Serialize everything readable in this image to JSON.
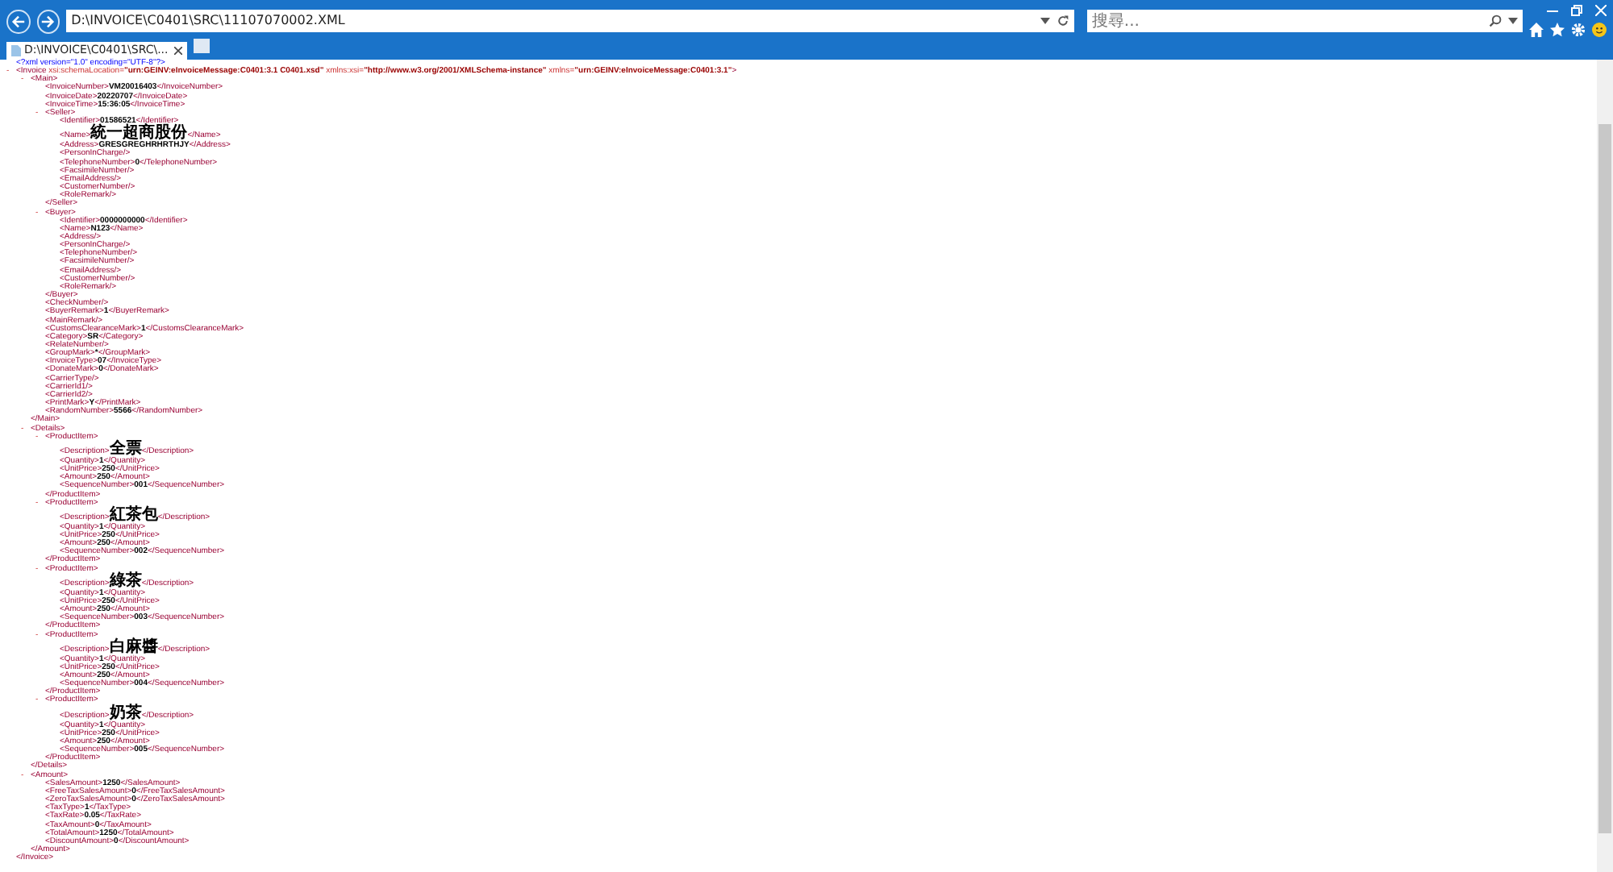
{
  "browser": {
    "address": "D:\\INVOICE\\C0401\\SRC\\11107070002.XML",
    "search_placeholder": "搜尋...",
    "tab_title": "D:\\INVOICE\\C0401\\SRC\\..."
  },
  "declaration": "<?xml version=\"1.0\" encoding=\"UTF-8\"?>",
  "root": {
    "toggle": "-",
    "open": "<Invoice",
    "attributes": [
      {
        "name": " xsi:schemaLocation=",
        "value": "\"urn:GEINV:eInvoiceMessage:C0401:3.1 C0401.xsd\""
      },
      {
        "name": " xmlns:xsi=",
        "value": "\"http://www.w3.org/2001/XMLSchema-instance\""
      },
      {
        "name": " xmlns=",
        "value": "\"urn:GEINV:eInvoiceMessage:C0401:3.1\""
      }
    ],
    "open_end": ">",
    "close": "</Invoice>",
    "children": [
      {
        "toggle": "-",
        "open": "<Main>",
        "close": "</Main>",
        "children": [
          {
            "open": "<InvoiceNumber>",
            "value": "VM20016403",
            "close": "</InvoiceNumber>"
          },
          {
            "open": "<InvoiceDate>",
            "value": "20220707",
            "close": "</InvoiceDate>"
          },
          {
            "open": "<InvoiceTime>",
            "value": "15:36:05",
            "close": "</InvoiceTime>"
          },
          {
            "toggle": "-",
            "open": "<Seller>",
            "close": "</Seller>",
            "children": [
              {
                "open": "<Identifier>",
                "value": "01586521",
                "close": "</Identifier>"
              },
              {
                "open": "<Name>",
                "value": "統一超商股份",
                "close": "</Name>"
              },
              {
                "open": "<Address>",
                "value": "GRESGREGHRHRTHJY",
                "close": "</Address>"
              },
              {
                "open": "<PersonInCharge/>"
              },
              {
                "open": "<TelephoneNumber>",
                "value": "0",
                "close": "</TelephoneNumber>"
              },
              {
                "open": "<FacsimileNumber/>"
              },
              {
                "open": "<EmailAddress/>"
              },
              {
                "open": "<CustomerNumber/>"
              },
              {
                "open": "<RoleRemark/>"
              }
            ]
          },
          {
            "toggle": "-",
            "open": "<Buyer>",
            "close": "</Buyer>",
            "children": [
              {
                "open": "<Identifier>",
                "value": "0000000000",
                "close": "</Identifier>"
              },
              {
                "open": "<Name>",
                "value": "N123",
                "close": "</Name>"
              },
              {
                "open": "<Address/>"
              },
              {
                "open": "<PersonInCharge/>"
              },
              {
                "open": "<TelephoneNumber/>"
              },
              {
                "open": "<FacsimileNumber/>"
              },
              {
                "open": "<EmailAddress/>"
              },
              {
                "open": "<CustomerNumber/>"
              },
              {
                "open": "<RoleRemark/>"
              }
            ]
          },
          {
            "open": "<CheckNumber/>"
          },
          {
            "open": "<BuyerRemark>",
            "value": "1",
            "close": "</BuyerRemark>"
          },
          {
            "open": "<MainRemark/>"
          },
          {
            "open": "<CustomsClearanceMark>",
            "value": "1",
            "close": "</CustomsClearanceMark>"
          },
          {
            "open": "<Category>",
            "value": "SR",
            "close": "</Category>"
          },
          {
            "open": "<RelateNumber/>"
          },
          {
            "open": "<GroupMark>",
            "value": "*",
            "close": "</GroupMark>"
          },
          {
            "open": "<InvoiceType>",
            "value": "07",
            "close": "</InvoiceType>"
          },
          {
            "open": "<DonateMark>",
            "value": "0",
            "close": "</DonateMark>"
          },
          {
            "open": "<CarrierType/>"
          },
          {
            "open": "<CarrierId1/>"
          },
          {
            "open": "<CarrierId2/>"
          },
          {
            "open": "<PrintMark>",
            "value": "Y",
            "close": "</PrintMark>"
          },
          {
            "open": "<RandomNumber>",
            "value": "5566",
            "close": "</RandomNumber>"
          }
        ]
      },
      {
        "toggle": "-",
        "open": "<Details>",
        "close": "</Details>",
        "children": [
          {
            "toggle": "-",
            "open": "<ProductItem>",
            "close": "</ProductItem>",
            "children": [
              {
                "open": "<Description>",
                "value": "全票",
                "close": "</Description>"
              },
              {
                "open": "<Quantity>",
                "value": "1",
                "close": "</Quantity>"
              },
              {
                "open": "<UnitPrice>",
                "value": "250",
                "close": "</UnitPrice>"
              },
              {
                "open": "<Amount>",
                "value": "250",
                "close": "</Amount>"
              },
              {
                "open": "<SequenceNumber>",
                "value": "001",
                "close": "</SequenceNumber>"
              }
            ]
          },
          {
            "toggle": "-",
            "open": "<ProductItem>",
            "close": "</ProductItem>",
            "children": [
              {
                "open": "<Description>",
                "value": "紅茶包",
                "close": "</Description>"
              },
              {
                "open": "<Quantity>",
                "value": "1",
                "close": "</Quantity>"
              },
              {
                "open": "<UnitPrice>",
                "value": "250",
                "close": "</UnitPrice>"
              },
              {
                "open": "<Amount>",
                "value": "250",
                "close": "</Amount>"
              },
              {
                "open": "<SequenceNumber>",
                "value": "002",
                "close": "</SequenceNumber>"
              }
            ]
          },
          {
            "toggle": "-",
            "open": "<ProductItem>",
            "close": "</ProductItem>",
            "children": [
              {
                "open": "<Description>",
                "value": "綠茶",
                "close": "</Description>"
              },
              {
                "open": "<Quantity>",
                "value": "1",
                "close": "</Quantity>"
              },
              {
                "open": "<UnitPrice>",
                "value": "250",
                "close": "</UnitPrice>"
              },
              {
                "open": "<Amount>",
                "value": "250",
                "close": "</Amount>"
              },
              {
                "open": "<SequenceNumber>",
                "value": "003",
                "close": "</SequenceNumber>"
              }
            ]
          },
          {
            "toggle": "-",
            "open": "<ProductItem>",
            "close": "</ProductItem>",
            "children": [
              {
                "open": "<Description>",
                "value": "白麻醬",
                "close": "</Description>"
              },
              {
                "open": "<Quantity>",
                "value": "1",
                "close": "</Quantity>"
              },
              {
                "open": "<UnitPrice>",
                "value": "250",
                "close": "</UnitPrice>"
              },
              {
                "open": "<Amount>",
                "value": "250",
                "close": "</Amount>"
              },
              {
                "open": "<SequenceNumber>",
                "value": "004",
                "close": "</SequenceNumber>"
              }
            ]
          },
          {
            "toggle": "-",
            "open": "<ProductItem>",
            "close": "</ProductItem>",
            "children": [
              {
                "open": "<Description>",
                "value": "奶茶",
                "close": "</Description>"
              },
              {
                "open": "<Quantity>",
                "value": "1",
                "close": "</Quantity>"
              },
              {
                "open": "<UnitPrice>",
                "value": "250",
                "close": "</UnitPrice>"
              },
              {
                "open": "<Amount>",
                "value": "250",
                "close": "</Amount>"
              },
              {
                "open": "<SequenceNumber>",
                "value": "005",
                "close": "</SequenceNumber>"
              }
            ]
          }
        ]
      },
      {
        "toggle": "-",
        "open": "<Amount>",
        "close": "</Amount>",
        "children": [
          {
            "open": "<SalesAmount>",
            "value": "1250",
            "close": "</SalesAmount>"
          },
          {
            "open": "<FreeTaxSalesAmount>",
            "value": "0",
            "close": "</FreeTaxSalesAmount>"
          },
          {
            "open": "<ZeroTaxSalesAmount>",
            "value": "0",
            "close": "</ZeroTaxSalesAmount>"
          },
          {
            "open": "<TaxType>",
            "value": "1",
            "close": "</TaxType>"
          },
          {
            "open": "<TaxRate>",
            "value": "0.05",
            "close": "</TaxRate>"
          },
          {
            "open": "<TaxAmount>",
            "value": "0",
            "close": "</TaxAmount>"
          },
          {
            "open": "<TotalAmount>",
            "value": "1250",
            "close": "</TotalAmount>"
          },
          {
            "open": "<DiscountAmount>",
            "value": "0",
            "close": "</DiscountAmount>"
          }
        ]
      }
    ]
  }
}
